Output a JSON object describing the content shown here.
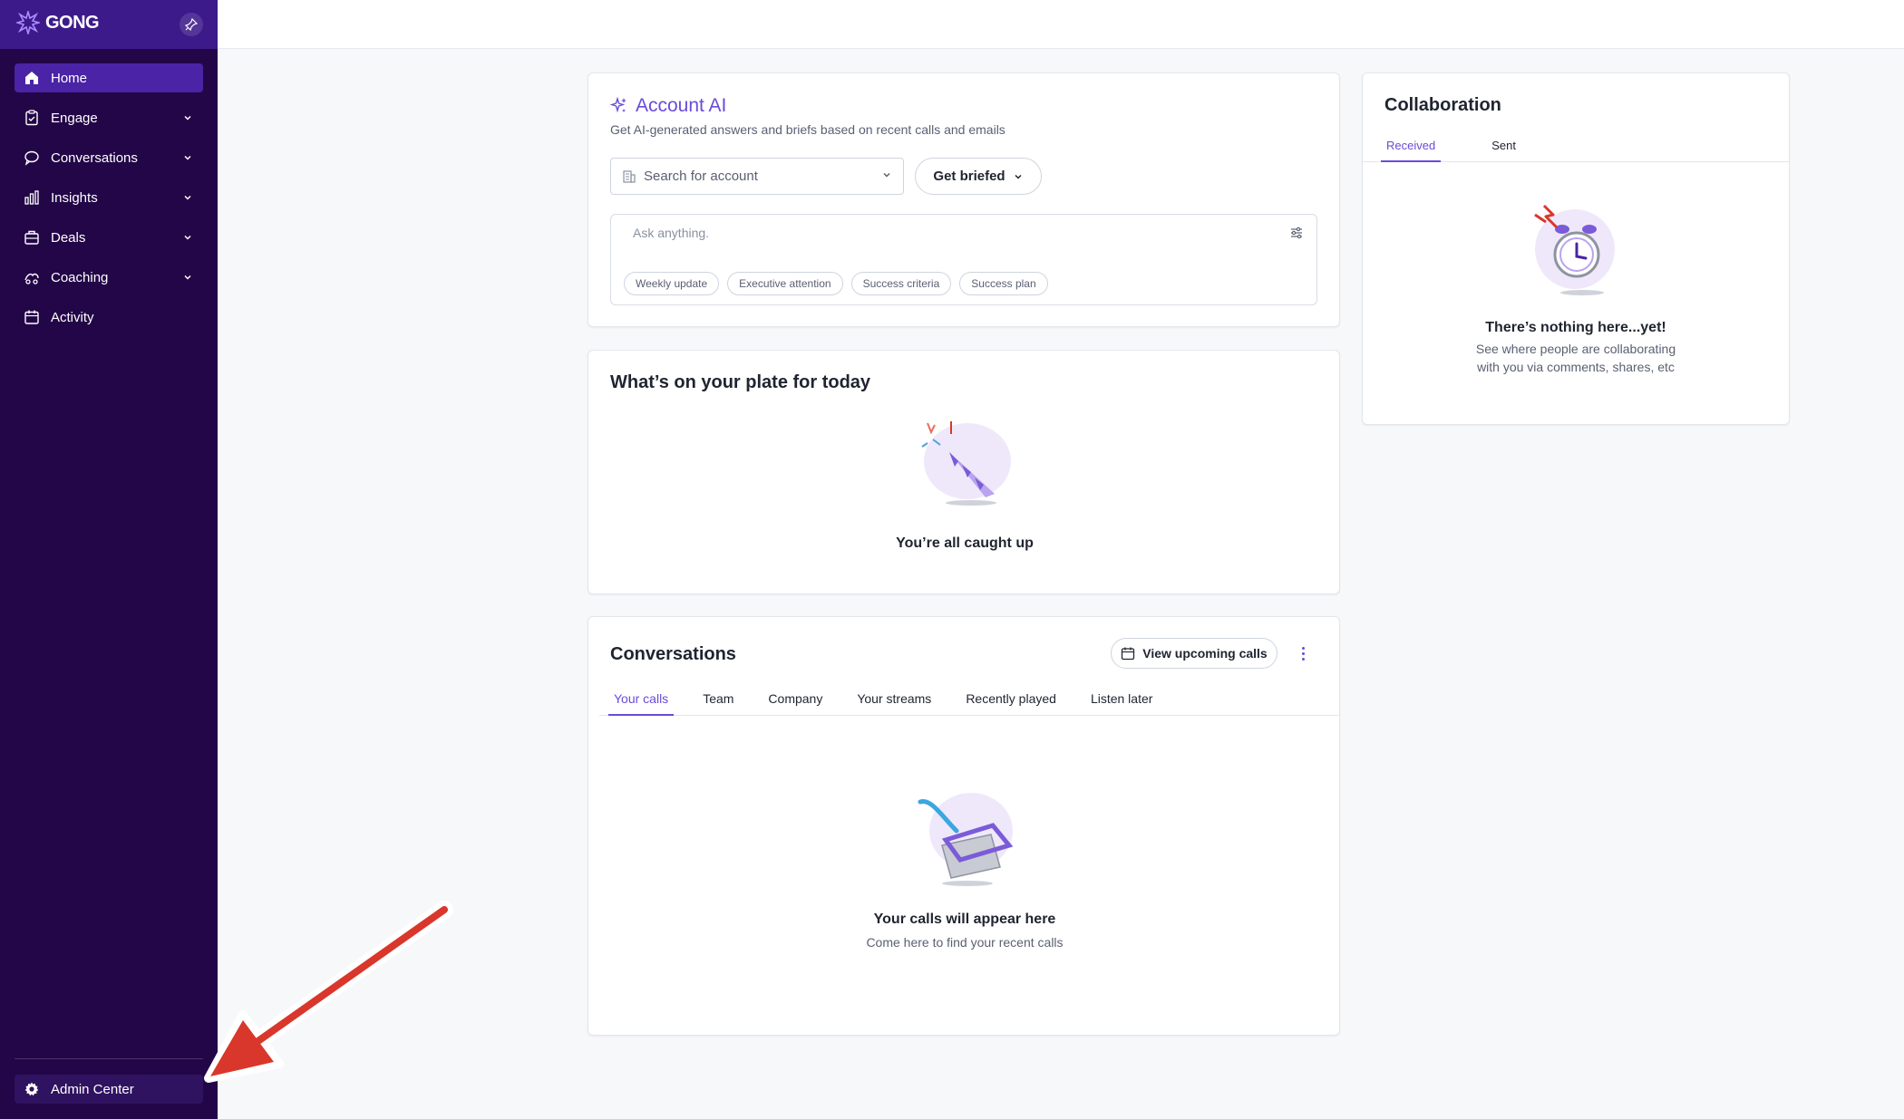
{
  "app": {
    "logo_text": "GONG"
  },
  "sidebar": {
    "items": [
      {
        "label": "Home",
        "icon": "home-icon",
        "active": true,
        "has_chevron": false
      },
      {
        "label": "Engage",
        "icon": "clipboard-icon",
        "has_chevron": true
      },
      {
        "label": "Conversations",
        "icon": "chat-icon",
        "has_chevron": true
      },
      {
        "label": "Insights",
        "icon": "bar-chart-icon",
        "has_chevron": true
      },
      {
        "label": "Deals",
        "icon": "briefcase-icon",
        "has_chevron": true
      },
      {
        "label": "Coaching",
        "icon": "coaching-icon",
        "has_chevron": true
      },
      {
        "label": "Activity",
        "icon": "calendar-icon",
        "has_chevron": false
      }
    ],
    "admin_label": "Admin Center"
  },
  "account_ai": {
    "title": "Account AI",
    "subtitle": "Get AI-generated answers and briefs based on recent calls and emails",
    "search_placeholder": "Search for account",
    "briefed_label": "Get briefed",
    "ask_placeholder": "Ask anything.",
    "chips": [
      "Weekly update",
      "Executive attention",
      "Success criteria",
      "Success plan"
    ]
  },
  "plate": {
    "title": "What’s on your plate for today",
    "empty_title": "You’re all caught up"
  },
  "conversations": {
    "title": "Conversations",
    "upcoming_label": "View upcoming calls",
    "tabs": [
      "Your calls",
      "Team",
      "Company",
      "Your streams",
      "Recently played",
      "Listen later"
    ],
    "active_tab": "Your calls",
    "empty_title": "Your calls will appear here",
    "empty_sub": "Come here to find your recent calls"
  },
  "collaboration": {
    "title": "Collaboration",
    "tabs": [
      "Received",
      "Sent"
    ],
    "active_tab": "Received",
    "empty_title": "There’s nothing here...yet!",
    "empty_sub_line1": "See where people are collaborating",
    "empty_sub_line2": "with you via comments, shares, etc"
  },
  "colors": {
    "sidebar_bg": "#230647",
    "logo_bar_bg": "#3d1a8a",
    "active_item": "#4a23a6",
    "accent": "#6a4bd8",
    "annotation_arrow": "#d9372b"
  }
}
